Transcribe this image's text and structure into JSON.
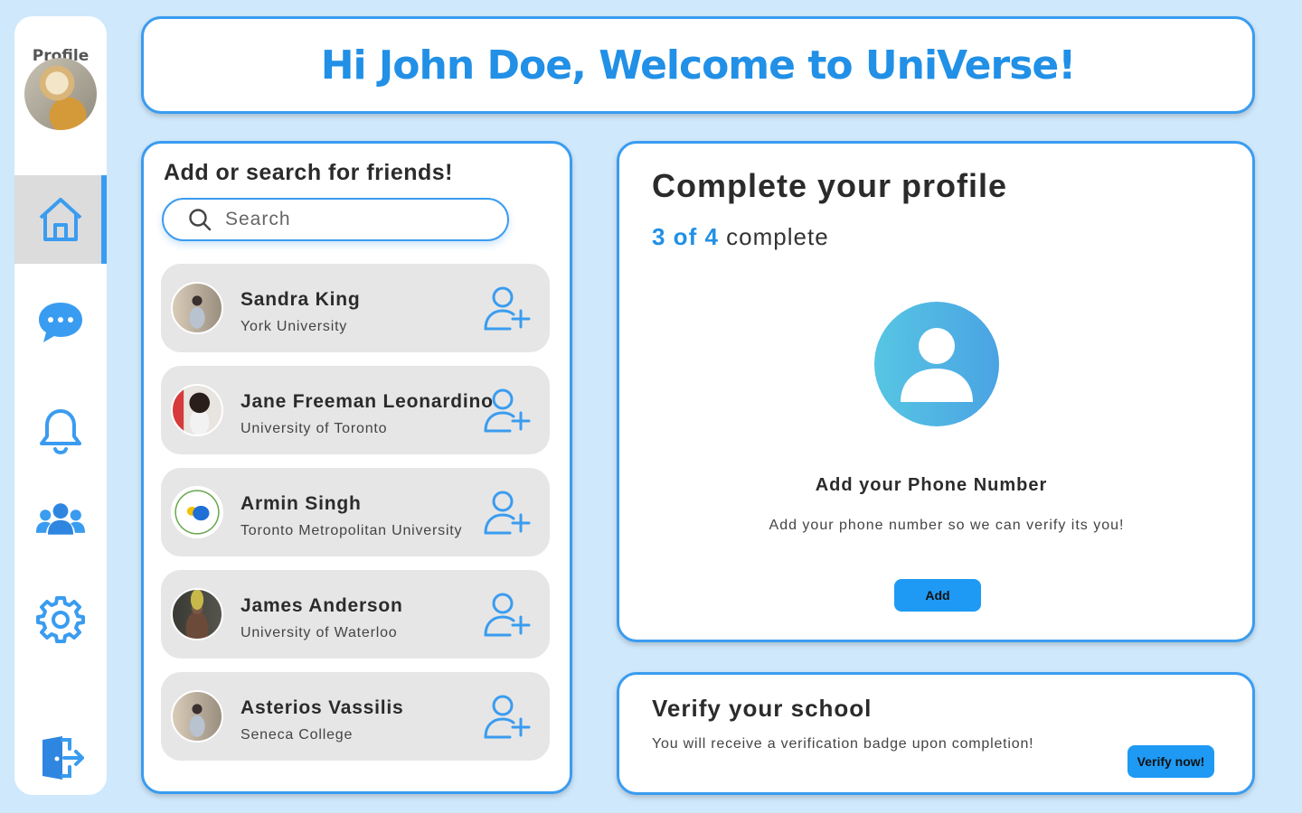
{
  "sidebar": {
    "profile_label": "Profile",
    "nav": [
      {
        "icon": "home-icon",
        "active": true
      },
      {
        "icon": "chat-icon",
        "active": false
      },
      {
        "icon": "bell-icon",
        "active": false
      },
      {
        "icon": "people-icon",
        "active": false
      },
      {
        "icon": "gear-icon",
        "active": false
      },
      {
        "icon": "logout-icon",
        "active": false
      }
    ]
  },
  "header": {
    "title": "Hi John Doe, Welcome to UniVerse!"
  },
  "friends": {
    "title": "Add or search for friends!",
    "search_placeholder": "Search",
    "items": [
      {
        "name": "Sandra King",
        "school": "York University"
      },
      {
        "name": "Jane Freeman Leonardino",
        "school": "University of Toronto"
      },
      {
        "name": "Armin Singh",
        "school": "Toronto Metropolitan University"
      },
      {
        "name": "James Anderson",
        "school": "University of Waterloo"
      },
      {
        "name": "Asterios Vassilis",
        "school": "Seneca College"
      }
    ]
  },
  "profile_card": {
    "title": "Complete your profile",
    "progress_done": "3 of 4",
    "progress_suffix": "complete",
    "progress_fraction": 0.75,
    "step_title": "Add your Phone Number",
    "step_desc": "Add your phone number so we can verify its you!",
    "add_label": "Add"
  },
  "verify_card": {
    "title": "Verify your school",
    "desc": "You will receive a verification badge upon completion!",
    "button_label": "Verify now!"
  },
  "colors": {
    "accent": "#3a9cf0",
    "background": "#cfe8fb",
    "button": "#1e9af5"
  }
}
